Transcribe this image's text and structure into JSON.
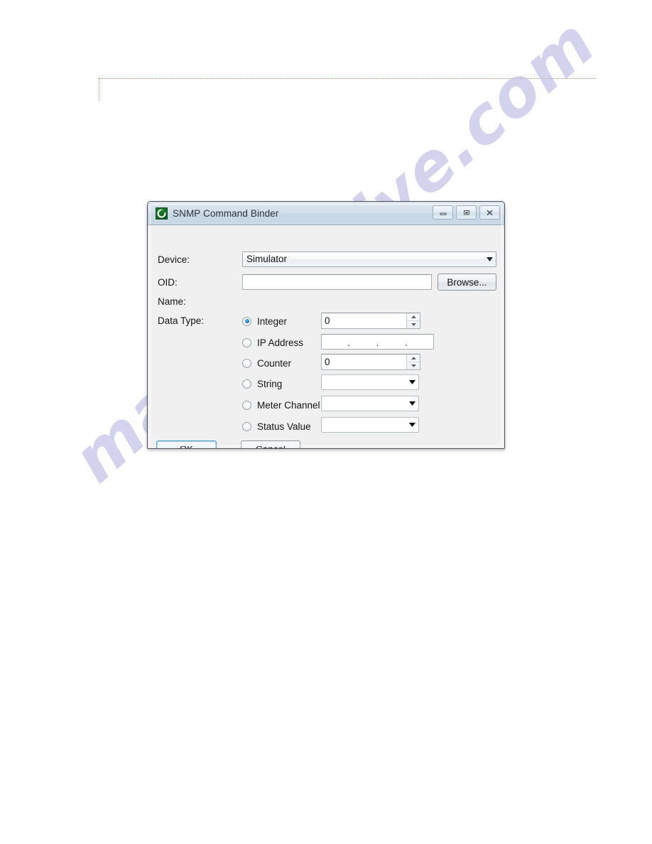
{
  "page": {
    "watermark": "manualshive.com"
  },
  "dialog": {
    "title": "SNMP Command Binder",
    "icon": "app-logo-icon",
    "caption_buttons": [
      {
        "name": "minimize",
        "label": "Minimize"
      },
      {
        "name": "restore",
        "label": "Restore"
      },
      {
        "name": "close",
        "label": "Close"
      }
    ],
    "fields": {
      "device_label": "Device:",
      "device_value": "Simulator",
      "oid_label": "OID:",
      "oid_value": "",
      "browse_label": "Browse...",
      "name_label": "Name:",
      "name_value": "",
      "data_type_label": "Data Type:"
    },
    "data_types": [
      {
        "label": "Integer",
        "selected": true,
        "control": "spinner",
        "value": "0"
      },
      {
        "label": "IP Address",
        "selected": false,
        "control": "ip",
        "value": ""
      },
      {
        "label": "Counter",
        "selected": false,
        "control": "spinner",
        "value": "0"
      },
      {
        "label": "String",
        "selected": false,
        "control": "combo",
        "value": ""
      },
      {
        "label": "Meter Channel",
        "selected": false,
        "control": "combo",
        "value": ""
      },
      {
        "label": "Status Value",
        "selected": false,
        "control": "combo",
        "value": ""
      }
    ],
    "buttons": {
      "ok": "OK",
      "cancel": "Cancel"
    },
    "colors": {
      "titlebar": "#d3dfea",
      "body": "#f0f0f0",
      "accent": "#1a72b8",
      "focus_border": "#4d9fc9",
      "icon_green": "#1a7a2e"
    }
  }
}
